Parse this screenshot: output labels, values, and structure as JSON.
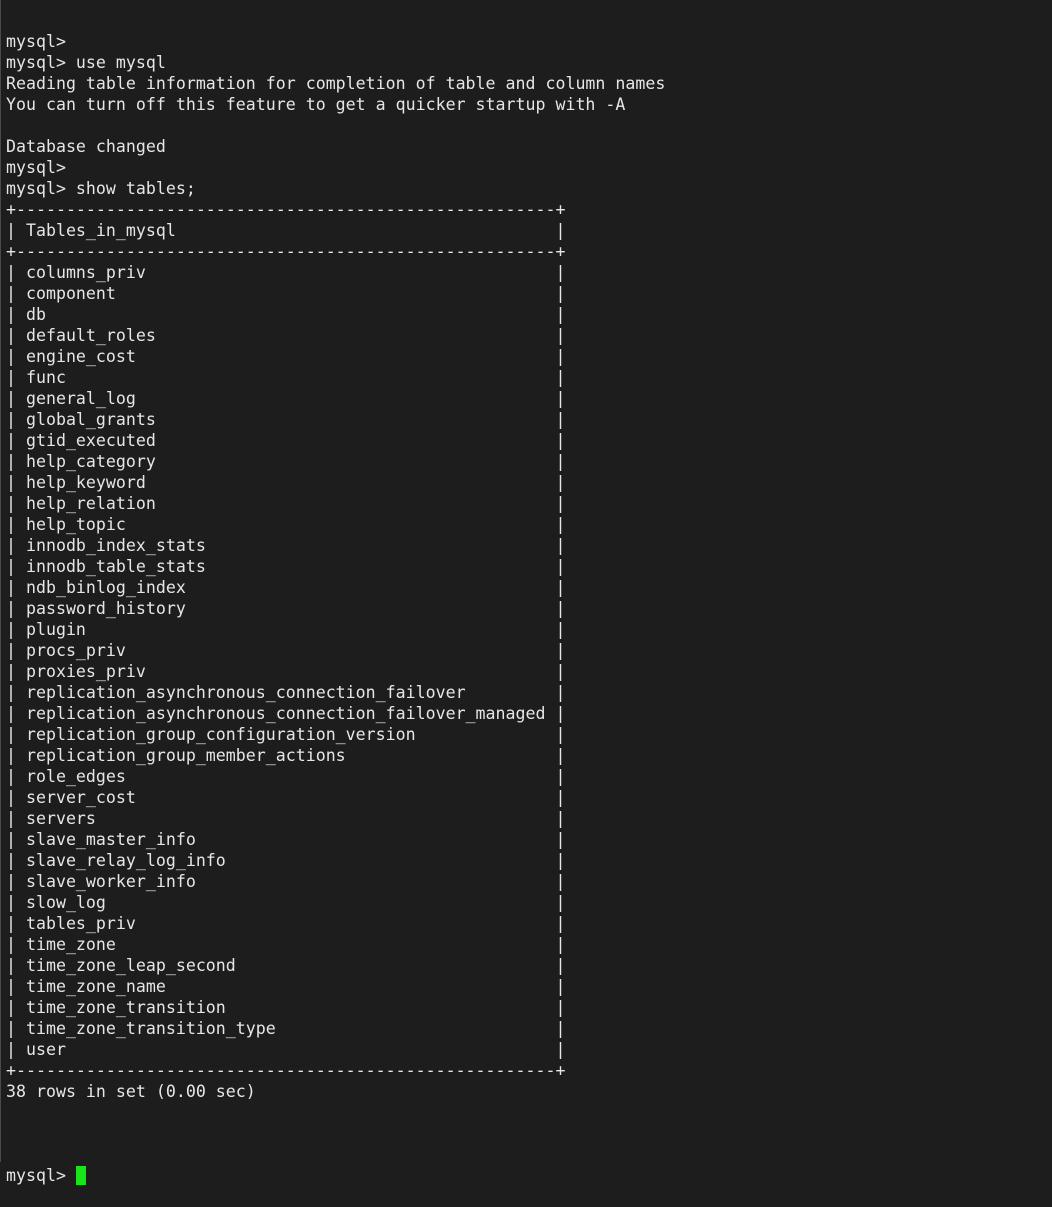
{
  "terminal": {
    "lines": [
      "mysql>",
      "mysql> use mysql",
      "Reading table information for completion of table and column names",
      "You can turn off this feature to get a quicker startup with -A",
      "",
      "Database changed",
      "mysql>",
      "mysql> show tables;",
      "+------------------------------------------------------+",
      "| Tables_in_mysql                                      |",
      "+------------------------------------------------------+",
      "| columns_priv                                         |",
      "| component                                            |",
      "| db                                                   |",
      "| default_roles                                        |",
      "| engine_cost                                          |",
      "| func                                                 |",
      "| general_log                                          |",
      "| global_grants                                        |",
      "| gtid_executed                                        |",
      "| help_category                                        |",
      "| help_keyword                                         |",
      "| help_relation                                        |",
      "| help_topic                                           |",
      "| innodb_index_stats                                   |",
      "| innodb_table_stats                                   |",
      "| ndb_binlog_index                                     |",
      "| password_history                                     |",
      "| plugin                                               |",
      "| procs_priv                                           |",
      "| proxies_priv                                         |",
      "| replication_asynchronous_connection_failover         |",
      "| replication_asynchronous_connection_failover_managed |",
      "| replication_group_configuration_version              |",
      "| replication_group_member_actions                     |",
      "| role_edges                                           |",
      "| server_cost                                          |",
      "| servers                                              |",
      "| slave_master_info                                    |",
      "| slave_relay_log_info                                 |",
      "| slave_worker_info                                    |",
      "| slow_log                                             |",
      "| tables_priv                                          |",
      "| time_zone                                            |",
      "| time_zone_leap_second                                |",
      "| time_zone_name                                       |",
      "| time_zone_transition                                 |",
      "| time_zone_transition_type                            |",
      "| user                                                 |",
      "+------------------------------------------------------+",
      "38 rows in set (0.00 sec)",
      ""
    ],
    "prompt": "mysql> ",
    "colors": {
      "background": "#1d1d1d",
      "text": "#e6e6e6",
      "cursor": "#19e619"
    }
  }
}
